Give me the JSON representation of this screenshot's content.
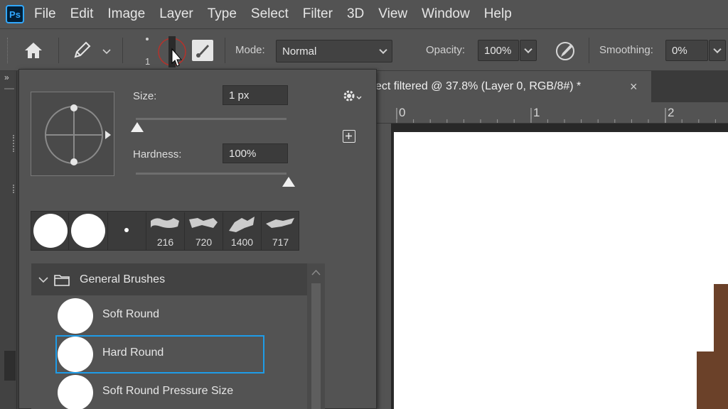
{
  "menubar": {
    "app_badge": "Ps",
    "items": [
      "File",
      "Edit",
      "Image",
      "Layer",
      "Type",
      "Select",
      "Filter",
      "3D",
      "View",
      "Window",
      "Help"
    ]
  },
  "options": {
    "brush_size_indicator": "1",
    "mode_label": "Mode:",
    "mode_value": "Normal",
    "opacity_label": "Opacity:",
    "opacity_value": "100%",
    "smoothing_label": "Smoothing:",
    "smoothing_value": "0%"
  },
  "document": {
    "tab_title": "ect filtered @ 37.8% (Layer 0, RGB/8#) *",
    "close_glyph": "×",
    "ruler_ticks": [
      "0",
      "1",
      "2"
    ]
  },
  "brush_picker": {
    "size_label": "Size:",
    "size_value": "1 px",
    "hardness_label": "Hardness:",
    "hardness_value": "100%",
    "size_slider_fraction": 0.0,
    "hardness_slider_fraction": 1.0,
    "recent_brushes": [
      {
        "kind": "hard-round-large",
        "count": ""
      },
      {
        "kind": "hard-round-large",
        "count": ""
      },
      {
        "kind": "dot-small",
        "count": ""
      },
      {
        "kind": "texture",
        "count": "216"
      },
      {
        "kind": "texture",
        "count": "720"
      },
      {
        "kind": "texture",
        "count": "1400"
      },
      {
        "kind": "texture",
        "count": "717"
      }
    ],
    "group_name": "General Brushes",
    "brushes": [
      {
        "name": "Soft Round",
        "selected": false
      },
      {
        "name": "Hard Round",
        "selected": true
      },
      {
        "name": "Soft Round Pressure Size",
        "selected": false
      }
    ]
  },
  "colors": {
    "accent": "#31a8ff",
    "selection_border": "#1e9ce8",
    "brown_shape": "#6b4129"
  }
}
